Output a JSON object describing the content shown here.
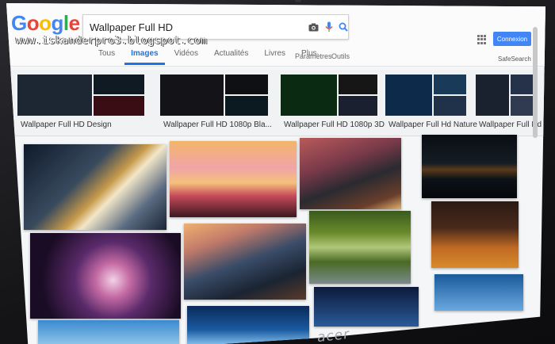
{
  "watermark": "www.iskanderpro3.blogspot.com",
  "header": {
    "logo_letters": [
      "G",
      "o",
      "o",
      "g",
      "l",
      "e"
    ],
    "search_value": "Wallpaper Full HD",
    "search_icons": [
      "camera-icon",
      "microphone-icon",
      "search-icon"
    ],
    "tabs": [
      {
        "label": "Tous",
        "active": false
      },
      {
        "label": "Images",
        "active": true
      },
      {
        "label": "Vidéos",
        "active": false
      },
      {
        "label": "Actualités",
        "active": false
      },
      {
        "label": "Livres",
        "active": false
      },
      {
        "label": "Plus",
        "active": false
      }
    ],
    "tool_links": [
      "Paramètres",
      "Outils"
    ],
    "signin_label": "Connexion",
    "safesearch_label": "SafeSearch ▾"
  },
  "related": [
    {
      "label": "Wallpaper Full HD Design",
      "colors": [
        "#1d2733",
        "#0f1a22",
        "#3a0d14"
      ]
    },
    {
      "label": "Wallpaper Full HD 1080p Bla...",
      "colors": [
        "#141418",
        "#0e1014",
        "#0a1a20"
      ]
    },
    {
      "label": "Wallpaper Full HD 1080p 3D",
      "colors": [
        "#0a2a12",
        "#161616",
        "#1a2030"
      ]
    },
    {
      "label": "Wallpaper Full Hd Nature",
      "colors": [
        "#0e2a4a",
        "#1a3a5a",
        "#20324a"
      ]
    },
    {
      "label": "Wallpaper Full Hd Cit...",
      "colors": [
        "#1a2230",
        "#26324a",
        "#303a50"
      ]
    }
  ],
  "thumbnails": [
    {
      "name": "tiger-on-rock",
      "gradient": "linear-gradient(135deg,#0e1a2c 0%,#3a4a5e 40%,#c79a4a 55%,#f2e6c8 62%,#5a6a80 80%,#1a2436 100%)"
    },
    {
      "name": "sunset-tree",
      "gradient": "linear-gradient(180deg,#f3b66a 0%,#f0a4a8 35%,#f6c07a 55%,#c64a5a 72%,#3a1820 100%)"
    },
    {
      "name": "car-wheel",
      "gradient": "linear-gradient(160deg,#b85a5a 0%,#7a3a4a 35%,#2a2a30 60%,#6a3e2c 85%,#e0b070 100%)"
    },
    {
      "name": "night-road-lights",
      "gradient": "linear-gradient(180deg,#0a0e14 0%,#141c24 45%,#5a3a1a 55%,#0c1218 70%,#06080c 100%)"
    },
    {
      "name": "crystal-ball",
      "gradient": "radial-gradient(circle at 55% 55%,#f2d2e6 0%,#c46aa4 18%,#5a2a6a 40%,#1a0c24 75%)"
    },
    {
      "name": "coastal-city",
      "gradient": "linear-gradient(160deg,#f0b070 0%,#c07a6a 25%,#3a4c68 50%,#1a2432 75%,#5a3a2a 100%)"
    },
    {
      "name": "forest-road",
      "gradient": "linear-gradient(180deg,#3a5a1e 0%,#6a8a2a 30%,#b0c87a 50%,#4a6a24 70%,#7a8a8a 100%)"
    },
    {
      "name": "horse-field",
      "gradient": "linear-gradient(180deg,#2a1a14 0%,#4a2a1a 40%,#c06a24 70%,#d88a2a 100%)"
    },
    {
      "name": "blue-sky",
      "gradient": "linear-gradient(180deg,#3a8ad0 0%,#a8d6f0 100%)"
    },
    {
      "name": "blue-car",
      "gradient": "linear-gradient(180deg,#0a2a5a 0%,#1a5aa0 60%,#8ac4f0 100%)"
    },
    {
      "name": "blue-space",
      "gradient": "linear-gradient(180deg,#0c1a3a 0%,#2a5a9a 100%)"
    },
    {
      "name": "sky-clouds",
      "gradient": "linear-gradient(180deg,#1a5a9a 0%,#6aa8e0 100%)"
    }
  ],
  "brand": "acer"
}
